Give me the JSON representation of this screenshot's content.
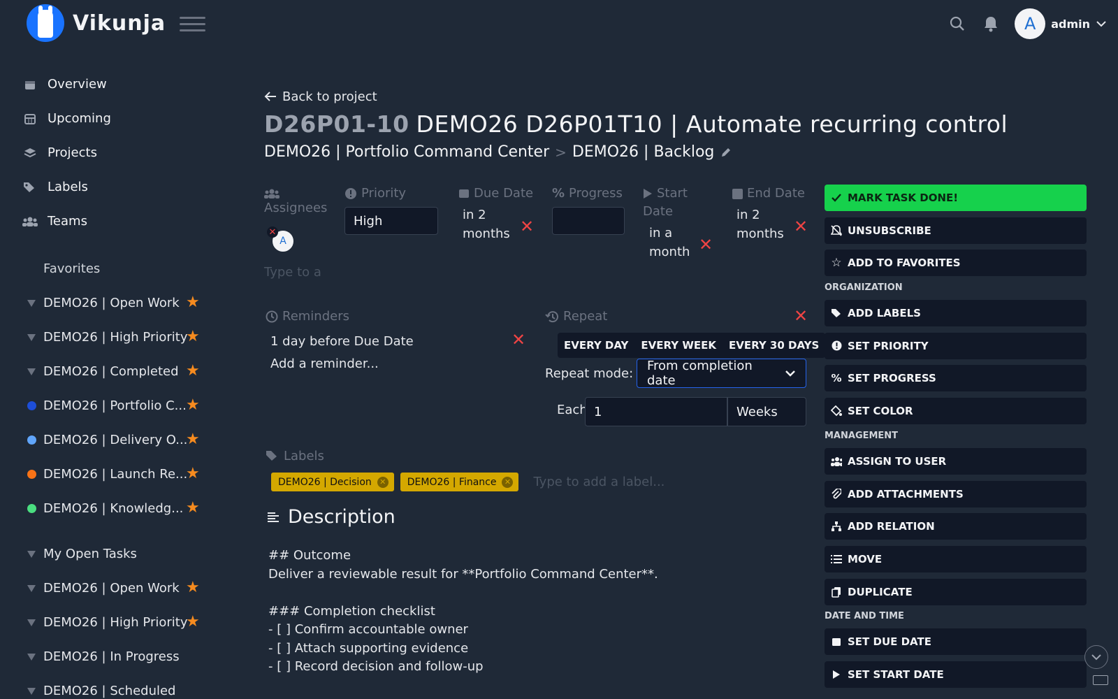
{
  "app": {
    "name": "Vikunja"
  },
  "header": {
    "user_initial": "A",
    "user_name": "admin"
  },
  "sidebar": {
    "nav": [
      {
        "label": "Overview",
        "icon": "calendar-icon"
      },
      {
        "label": "Upcoming",
        "icon": "calendar-grid-icon"
      },
      {
        "label": "Projects",
        "icon": "layers-icon"
      },
      {
        "label": "Labels",
        "icon": "tags-icon"
      },
      {
        "label": "Teams",
        "icon": "users-icon"
      }
    ],
    "favorites_title": "Favorites",
    "favorites": [
      {
        "label": "DEMO26 | Open Work",
        "kind": "filter"
      },
      {
        "label": "DEMO26 | High Priority",
        "kind": "filter"
      },
      {
        "label": "DEMO26 | Completed",
        "kind": "filter"
      },
      {
        "label": "DEMO26 | Portfolio C...",
        "kind": "project",
        "color": "#1d4ed8"
      },
      {
        "label": "DEMO26 | Delivery O...",
        "kind": "project",
        "color": "#60a5fa"
      },
      {
        "label": "DEMO26 | Launch Re...",
        "kind": "project",
        "color": "#f97316"
      },
      {
        "label": "DEMO26 | Knowledg...",
        "kind": "project",
        "color": "#4ade80"
      }
    ],
    "my_open_tasks": "My Open Tasks",
    "filters": [
      {
        "label": "DEMO26 | Open Work",
        "starred": true
      },
      {
        "label": "DEMO26 | High Priority",
        "starred": true
      },
      {
        "label": "DEMO26 | In Progress",
        "starred": false
      },
      {
        "label": "DEMO26 | Scheduled",
        "starred": false
      }
    ]
  },
  "task": {
    "back_label": "Back to project",
    "identifier": "D26P01-10",
    "title": "DEMO26 D26P01T10 | Automate recurring control",
    "breadcrumb": {
      "parent": "DEMO26 | Portfolio Command Center",
      "separator": ">",
      "current": "DEMO26 | Backlog"
    },
    "fields": {
      "assignees_label": "Assignees",
      "assignee_initial": "A",
      "assignee_placeholder": "Type to a",
      "priority_label": "Priority",
      "priority_value": "High",
      "due_label": "Due Date",
      "due_value_1": "in 2",
      "due_value_2": "months",
      "progress_label": "Progress",
      "progress_value": "",
      "start_label_1": "Start",
      "start_label_2": "Date",
      "start_value_1": "in a",
      "start_value_2": "month",
      "end_label": "End Date",
      "end_value_1": "in 2",
      "end_value_2": "months"
    },
    "reminders": {
      "label": "Reminders",
      "item": "1 day before Due Date",
      "add": "Add a reminder..."
    },
    "repeat": {
      "label": "Repeat",
      "presets": [
        "EVERY DAY",
        "EVERY WEEK",
        "EVERY 30 DAYS"
      ],
      "mode_label": "Repeat mode:",
      "mode_value": "From completion date",
      "each_label": "Each",
      "each_amount": "1",
      "each_unit": "Weeks"
    },
    "labels": {
      "label": "Labels",
      "items": [
        "DEMO26 | Decision",
        "DEMO26 | Finance"
      ],
      "placeholder": "Type to add a label..."
    },
    "description": {
      "title": "Description",
      "body": "## Outcome\nDeliver a reviewable result for **Portfolio Command Center**.\n\n### Completion checklist\n- [ ] Confirm accountable owner\n- [ ] Attach supporting evidence\n- [ ] Record decision and follow-up"
    }
  },
  "actions": {
    "done": "MARK TASK DONE!",
    "unsubscribe": "UNSUBSCRIBE",
    "favorite": "ADD TO FAVORITES",
    "org_head": "ORGANIZATION",
    "add_labels": "ADD LABELS",
    "set_priority": "SET PRIORITY",
    "set_progress": "SET PROGRESS",
    "set_color": "SET COLOR",
    "mgmt_head": "MANAGEMENT",
    "assign": "ASSIGN TO USER",
    "attachments": "ADD ATTACHMENTS",
    "relation": "ADD RELATION",
    "move": "MOVE",
    "duplicate": "DUPLICATE",
    "date_head": "DATE AND TIME",
    "due": "SET DUE DATE",
    "start": "SET START DATE"
  }
}
